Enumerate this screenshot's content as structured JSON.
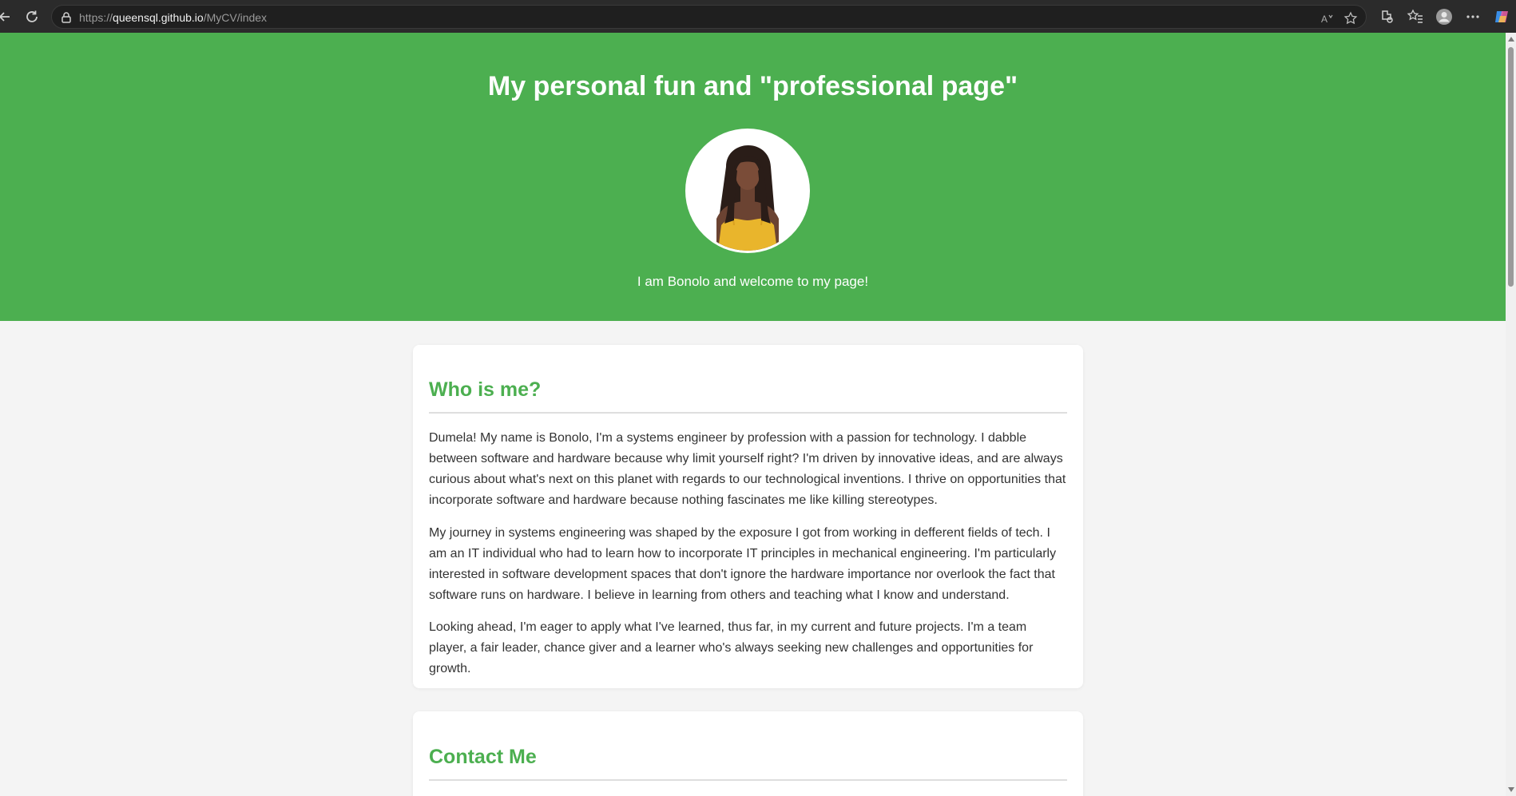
{
  "browser": {
    "url_scheme": "https://",
    "url_host": "queensql.github.io",
    "url_path": "/MyCV/index"
  },
  "hero": {
    "title": "My personal fun and \"professional page\"",
    "welcome": "I am Bonolo and welcome to my page!"
  },
  "about": {
    "heading": "Who is me?",
    "paragraphs": [
      "Dumela! My name is Bonolo, I'm a systems engineer by profession with a passion for technology. I dabble between software and hardware because why limit yourself right? I'm driven by innovative ideas, and are always curious about what's next on this planet with regards to our technological inventions. I thrive on opportunities that incorporate software and hardware because nothing fascinates me like killing stereotypes.",
      "My journey in systems engineering was shaped by the exposure I got from working in defferent fields of tech. I am an IT individual who had to learn how to incorporate IT principles in mechanical engineering. I'm particularly interested in software development spaces that don't ignore the hardware importance nor overlook the fact that software runs on hardware. I believe in learning from others and teaching what I know and understand.",
      "Looking ahead, I'm eager to apply what I've learned, thus far, in my current and future projects. I'm a team player, a fair leader, chance giver and a learner who's always seeking new challenges and opportunities for growth."
    ]
  },
  "contact": {
    "heading": "Contact Me"
  },
  "colors": {
    "accent": "#4caf50",
    "page_bg": "#f4f4f4",
    "card_bg": "#ffffff",
    "text": "#333333"
  }
}
